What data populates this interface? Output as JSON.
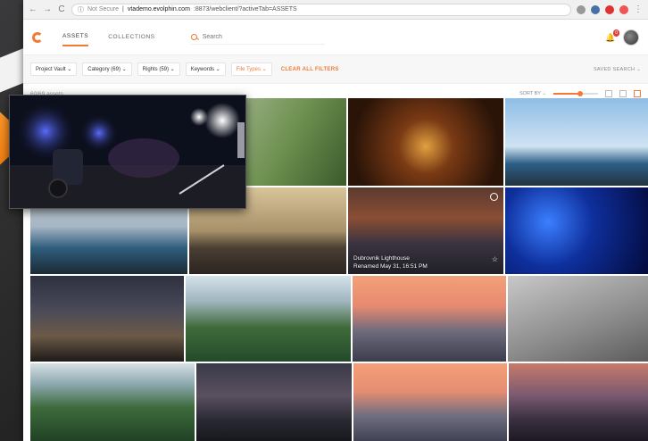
{
  "browser": {
    "secure_label": "Not Secure",
    "url_host": "vtademo.evolphin.com",
    "url_path": ":8873/webclient/?activeTab=ASSETS",
    "nav_back": "←",
    "nav_forward": "→",
    "nav_reload": "C"
  },
  "header": {
    "tabs": [
      {
        "label": "ASSETS"
      },
      {
        "label": "COLLECTIONS"
      }
    ],
    "search_placeholder": "Search",
    "notification_count": "0"
  },
  "filters": {
    "chips": [
      {
        "label": "Project Vault ⌄"
      },
      {
        "label": "Category (69) ⌄"
      },
      {
        "label": "Rights (59) ⌄"
      },
      {
        "label": "Keywords ⌄"
      },
      {
        "label": "File Types ⌄"
      }
    ],
    "clear_label": "CLEAR ALL FILTERS",
    "saved_search_label": "SAVED SEARCH ⌄"
  },
  "results": {
    "asset_count": "60/69 assets",
    "sort_label": "SORT BY ⌄",
    "zoom_level": 0.6
  },
  "tiles": [
    {
      "caption_title": "Dubrovnik Lighthouse",
      "caption_sub": "Renamed May 31, 16:51 PM"
    }
  ],
  "colors": {
    "accent": "#f07a36",
    "badge": "#e23d3d"
  }
}
